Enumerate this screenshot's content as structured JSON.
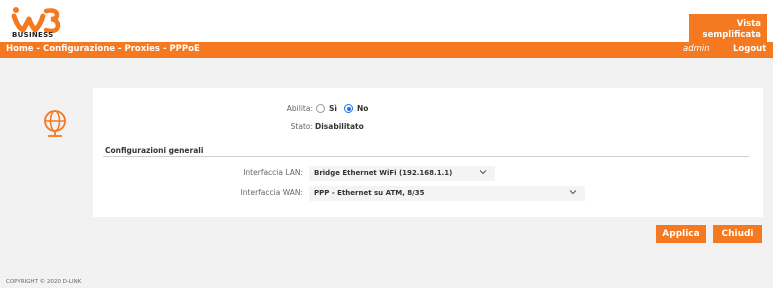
{
  "header": {
    "brand": "W3",
    "brand_subtitle": "BUSINESS",
    "vista_button_label": "Vista semplificata"
  },
  "navbar": {
    "breadcrumb": [
      "Home",
      "Configurazione",
      "Proxies",
      "PPPoE"
    ],
    "separator": " - ",
    "user": "admin",
    "logout_label": "Logout"
  },
  "form": {
    "abilita_label": "Abilita:",
    "abilita_options": [
      {
        "label": "Sì",
        "checked": false
      },
      {
        "label": "No",
        "checked": true
      }
    ],
    "stato_label": "Stato:",
    "stato_value": "Disabilitato",
    "section_title": "Configurazioni generali",
    "lan_label": "Interfaccia LAN:",
    "lan_value": "Bridge Ethernet WiFi (192.168.1.1)",
    "wan_label": "Interfaccia WAN:",
    "wan_value": "PPP - Ethernet su ATM, 8/35"
  },
  "actions": {
    "apply_label": "Applica",
    "close_label": "Chiudi"
  },
  "footer": {
    "copyright": "COPYRIGHT © 2020 D-LINK"
  },
  "colors": {
    "accent": "#f47920",
    "radio_checked": "#1a73e8",
    "page_bg": "#f2f2f2"
  },
  "icons": {
    "logo": "w3-logo-icon",
    "page": "globe-icon",
    "dropdown": "chevron-down-icon"
  }
}
